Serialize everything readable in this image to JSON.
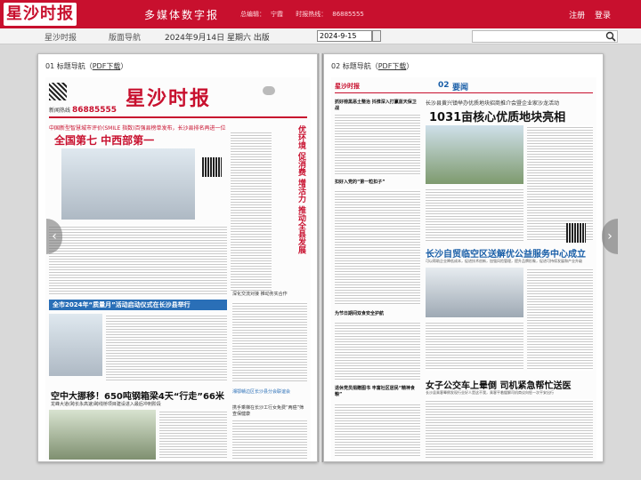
{
  "header": {
    "logo": "星沙时报",
    "site_title": "多媒体数字报",
    "editor_label": "总编辑：",
    "editor_name": "宁霞",
    "hotline_label": "时报热线：",
    "hotline": "86885555",
    "login": "注册",
    "register": "登录"
  },
  "nav": {
    "home": "星沙时报",
    "layout": "版面导航",
    "date_text": "2024年9月14日 星期六 出版",
    "date_value": "2024-9-15"
  },
  "left_page": {
    "label_prefix": "01 标题导航（",
    "pdf": "PDF下载",
    "label_suffix": "）",
    "masthead": "星沙时报",
    "hotline_prefix": "新闻热线",
    "hotline": "86885555",
    "headline_kicker": "中国新型智慧城市评价(SMILE 指数)百强县榜单发布，长沙县排名再进一位",
    "headline_main": "全国第七 中西部第一",
    "vertical_head": "优环境 促消费 增活力 推动全县发展",
    "blue_bar": "全市2024年“质量月”活动启动仪式在长沙县举行",
    "sub1": "深化交流对接 推动务实合作",
    "big_head": "空中大挪移！650吨钢箱梁4天“行走”66米",
    "small_head": "龙峰大道(跨长永高速)跨线桥项目建设进入最后冲刺阶段",
    "sub2": "湘鄂赣边区长沙县分会联谊会",
    "sub3": "携手乘梯在长沙工行女免费“两癌”筛查保健康"
  },
  "right_page": {
    "label_prefix": "02 标题导航（",
    "pdf": "PDF下载",
    "label_suffix": "）",
    "logo": "星沙时报",
    "page_num": "02",
    "section": "要闻",
    "kicker": "长沙县黄兴镇举办优质地块招商推介会暨企业家沙龙活动",
    "head1": "1031亩核心优质地块亮相",
    "head2": "长沙自贸临空区送解优公益服务中心成立",
    "head2_sub": "可以帮助企业降低成本，促进技术创新，加强风险管理，提升品牌形象，促进可持续发展和产业升级",
    "head3": "女子公交车上晕倒 司机紧急帮忙送医",
    "head3_sub": "长沙县乘客晕倒发现行业好人是这不我，乘客平着缓解司机商议向惩一次平安出行",
    "side1": "抓好榜黑恶土整治 抖推深入打赢蓝天保卫战",
    "side2": "扣好入党的“第一粒扣子”",
    "side3": "为节日期间双食安全护航",
    "side4": "退休党员捐赠图书 丰富社区居民“精神食粮”"
  },
  "icons": {
    "search": "search-icon",
    "calendar": "calendar-icon",
    "prev": "chevron-left-icon",
    "next": "chevron-right-icon"
  },
  "colors": {
    "brand": "#c8102e",
    "accent": "#2a6fb7"
  }
}
